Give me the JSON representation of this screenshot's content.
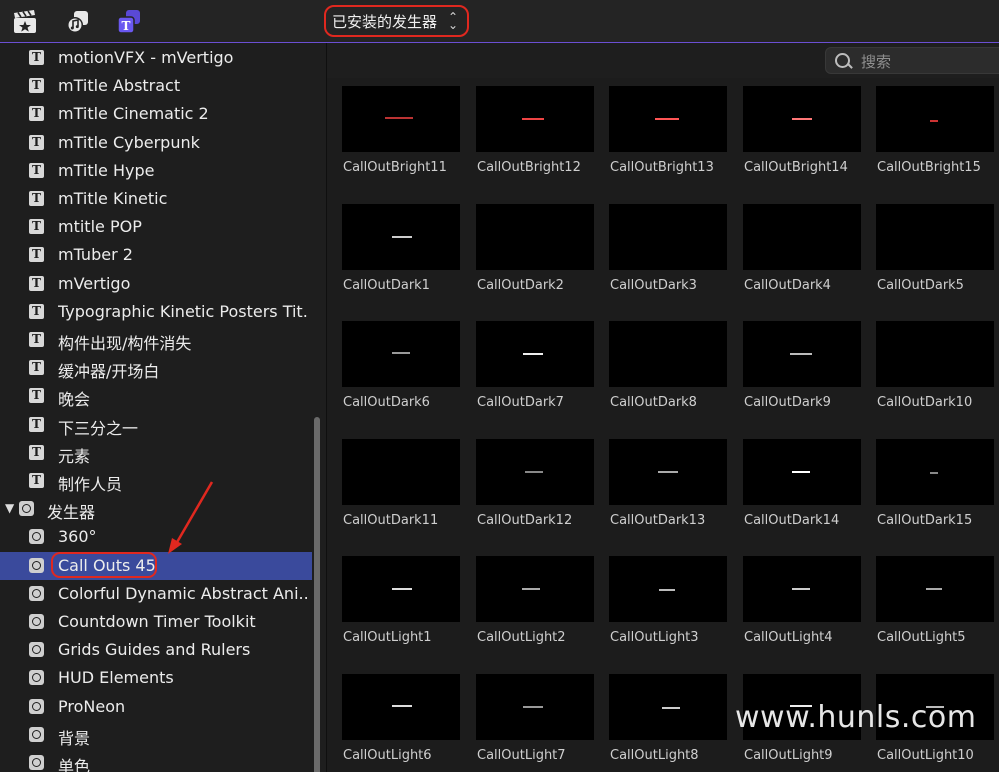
{
  "toolbar": {
    "icons": [
      "clapper-star-icon",
      "music-photo-icon",
      "titles-generators-icon"
    ],
    "source_select": "已安装的发生器"
  },
  "sidebar": {
    "items": [
      {
        "label": "motionVFX - mVertigo",
        "icon": "title-icon"
      },
      {
        "label": "mTitle Abstract",
        "icon": "title-icon"
      },
      {
        "label": "mTitle Cinematic 2",
        "icon": "title-icon"
      },
      {
        "label": "mTitle Cyberpunk",
        "icon": "title-icon"
      },
      {
        "label": "mTitle Hype",
        "icon": "title-icon"
      },
      {
        "label": "mTitle Kinetic",
        "icon": "title-icon"
      },
      {
        "label": "mtitle POP",
        "icon": "title-icon"
      },
      {
        "label": "mTuber 2",
        "icon": "title-icon"
      },
      {
        "label": "mVertigo",
        "icon": "title-icon"
      },
      {
        "label": "Typographic Kinetic Posters Tit...",
        "icon": "title-icon"
      },
      {
        "label": "构件出现/构件消失",
        "icon": "title-icon"
      },
      {
        "label": "缓冲器/开场白",
        "icon": "title-icon"
      },
      {
        "label": "晚会",
        "icon": "title-icon"
      },
      {
        "label": "下三分之一",
        "icon": "title-icon"
      },
      {
        "label": "元素",
        "icon": "title-icon"
      },
      {
        "label": "制作人员",
        "icon": "title-icon"
      }
    ],
    "group": {
      "label": "发生器",
      "expanded": true
    },
    "gen_items": [
      {
        "label": "360°"
      },
      {
        "label": "Call Outs 45",
        "selected": true
      },
      {
        "label": "Colorful Dynamic Abstract Ani..."
      },
      {
        "label": "Countdown Timer Toolkit"
      },
      {
        "label": "Grids Guides and Rulers"
      },
      {
        "label": "HUD Elements"
      },
      {
        "label": "ProNeon"
      },
      {
        "label": "背景"
      },
      {
        "label": "单色"
      }
    ]
  },
  "search": {
    "placeholder": "搜索",
    "value": ""
  },
  "browser": {
    "items": [
      "CallOutBright11",
      "CallOutBright12",
      "CallOutBright13",
      "CallOutBright14",
      "CallOutBright15",
      "CallOutDark1",
      "CallOutDark2",
      "CallOutDark3",
      "CallOutDark4",
      "CallOutDark5",
      "CallOutDark6",
      "CallOutDark7",
      "CallOutDark8",
      "CallOutDark9",
      "CallOutDark10",
      "CallOutDark11",
      "CallOutDark12",
      "CallOutDark13",
      "CallOutDark14",
      "CallOutDark15",
      "CallOutLight1",
      "CallOutLight2",
      "CallOutLight3",
      "CallOutLight4",
      "CallOutLight5",
      "CallOutLight6",
      "CallOutLight7",
      "CallOutLight8",
      "CallOutLight9",
      "CallOutLight10"
    ]
  },
  "watermark": "www.hunls.com",
  "colors": {
    "accent": "#6b4fd3",
    "selection": "#3a4a9c",
    "annotation": "#e0281f"
  }
}
